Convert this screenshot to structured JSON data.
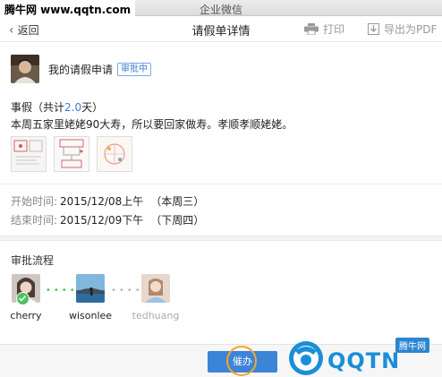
{
  "window": {
    "title": "企业微信"
  },
  "watermark_top": "腾牛网 www.qqtn.com",
  "header": {
    "back_label": "返回",
    "title": "请假单详情",
    "print_label": "打印",
    "export_label": "导出为PDF"
  },
  "applicant": {
    "title": "我的请假申请",
    "status": "审批中"
  },
  "leave": {
    "type_prefix": "事假（共计",
    "days": "2.0",
    "type_suffix": "天）",
    "reason": "本周五家里姥姥90大寿，所以要回家做寿。孝顺孝顺姥姥。",
    "attachments": [
      "attachment-1",
      "attachment-2",
      "attachment-3"
    ]
  },
  "time": {
    "start_label": "开始时间:",
    "start_value": "2015/12/08上午",
    "start_week": "（本周三）",
    "end_label": "结束时间:",
    "end_value": "2015/12/09下午",
    "end_week": "（下周四）"
  },
  "flow": {
    "label": "审批流程",
    "approvers": [
      {
        "name": "cherry",
        "state": "done"
      },
      {
        "name": "wisonlee",
        "state": "current"
      },
      {
        "name": "tedhuang",
        "state": "pending"
      }
    ]
  },
  "footer": {
    "urge_label": "催办"
  },
  "logo": {
    "text": "QQTN",
    "badge": "腾牛网"
  },
  "colors": {
    "accent": "#3b84d8",
    "done": "#4cc35f",
    "ring": "#f5a623"
  },
  "icons": {
    "back": "chevron-left-icon",
    "print": "printer-icon",
    "export": "download-icon",
    "check": "check-icon"
  }
}
